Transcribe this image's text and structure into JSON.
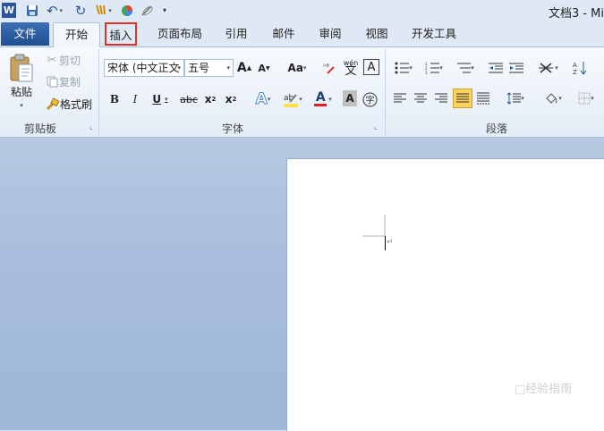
{
  "app": {
    "title": "文档3 - Mi",
    "quick_access": [
      "word-icon",
      "save-icon",
      "undo-icon",
      "redo-icon",
      "format-painter-icon",
      "color-icon",
      "eraser-icon",
      "customize-icon"
    ]
  },
  "tabs": [
    {
      "label": "文件",
      "state": "file"
    },
    {
      "label": "开始",
      "state": "selected"
    },
    {
      "label": "插入",
      "state": "highlighted"
    },
    {
      "label": "页面布局"
    },
    {
      "label": "引用"
    },
    {
      "label": "邮件"
    },
    {
      "label": "审阅"
    },
    {
      "label": "视图"
    },
    {
      "label": "开发工具"
    }
  ],
  "clipboard": {
    "paste_label": "粘贴",
    "cut_label": "剪切",
    "copy_label": "复制",
    "painter_label": "格式刷",
    "group_label": "剪贴板"
  },
  "font": {
    "family_value": "宋体 (中文正文",
    "size_value": "五号",
    "group_label": "字体",
    "aa_label": "Aa",
    "wen_label": "wén"
  },
  "paragraph": {
    "group_label": "段落"
  },
  "watermark": "□经验指南",
  "colors": {
    "file_tab": "#2b579a",
    "highlight_box": "#e0302a",
    "font_color": "#e02020",
    "highlight_yellow": "#ffe14d",
    "justify_active": "#fbd35c"
  }
}
